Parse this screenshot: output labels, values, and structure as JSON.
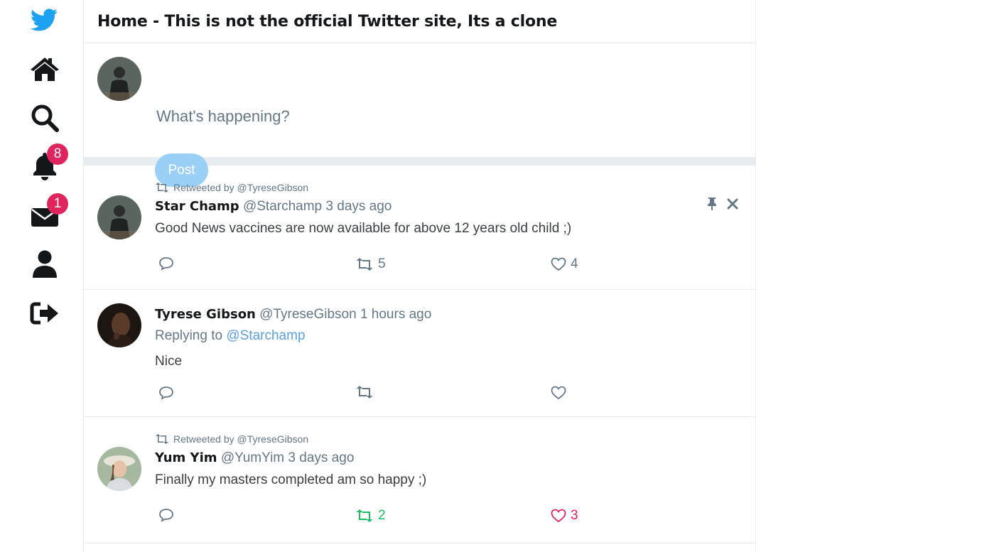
{
  "header": {
    "title": "Home - This is not the official Twitter site, Its a clone"
  },
  "sidebar": {
    "icons": [
      "bird-logo-icon",
      "home-icon",
      "search-icon",
      "bell-icon",
      "envelope-icon",
      "user-icon",
      "sign-out-icon"
    ],
    "notifications_badge": "8",
    "messages_badge": "1"
  },
  "composer": {
    "placeholder": "What's happening?",
    "post_label": "Post"
  },
  "tweets": [
    {
      "retweeted_by": "Retweeted by @TyreseGibson",
      "name": "Star Champ",
      "handle": "@Starchamp",
      "time": "3 days ago",
      "text": "Good News vaccines are now available for above 12 years old child ;)",
      "retweets": "5",
      "likes": "4"
    },
    {
      "name": "Tyrese Gibson",
      "handle": "@TyreseGibson",
      "time": "1 hours ago",
      "replying_to_prefix": "Replying to",
      "replying_to": "@Starchamp",
      "text": "Nice"
    },
    {
      "retweeted_by": "Retweeted by @TyreseGibson",
      "name": "Yum Yim",
      "handle": "@YumYim",
      "time": "3 days ago",
      "text": "Finally my masters completed am so happy ;)",
      "retweets": "2",
      "likes": "3"
    }
  ],
  "colors": {
    "accent": "#1da1f2",
    "post_button": "#9ad0f5",
    "retweet_active": "#17bf63",
    "like_active": "#e0245e",
    "badge": "#e0245e",
    "mention": "#5a9fe0"
  }
}
